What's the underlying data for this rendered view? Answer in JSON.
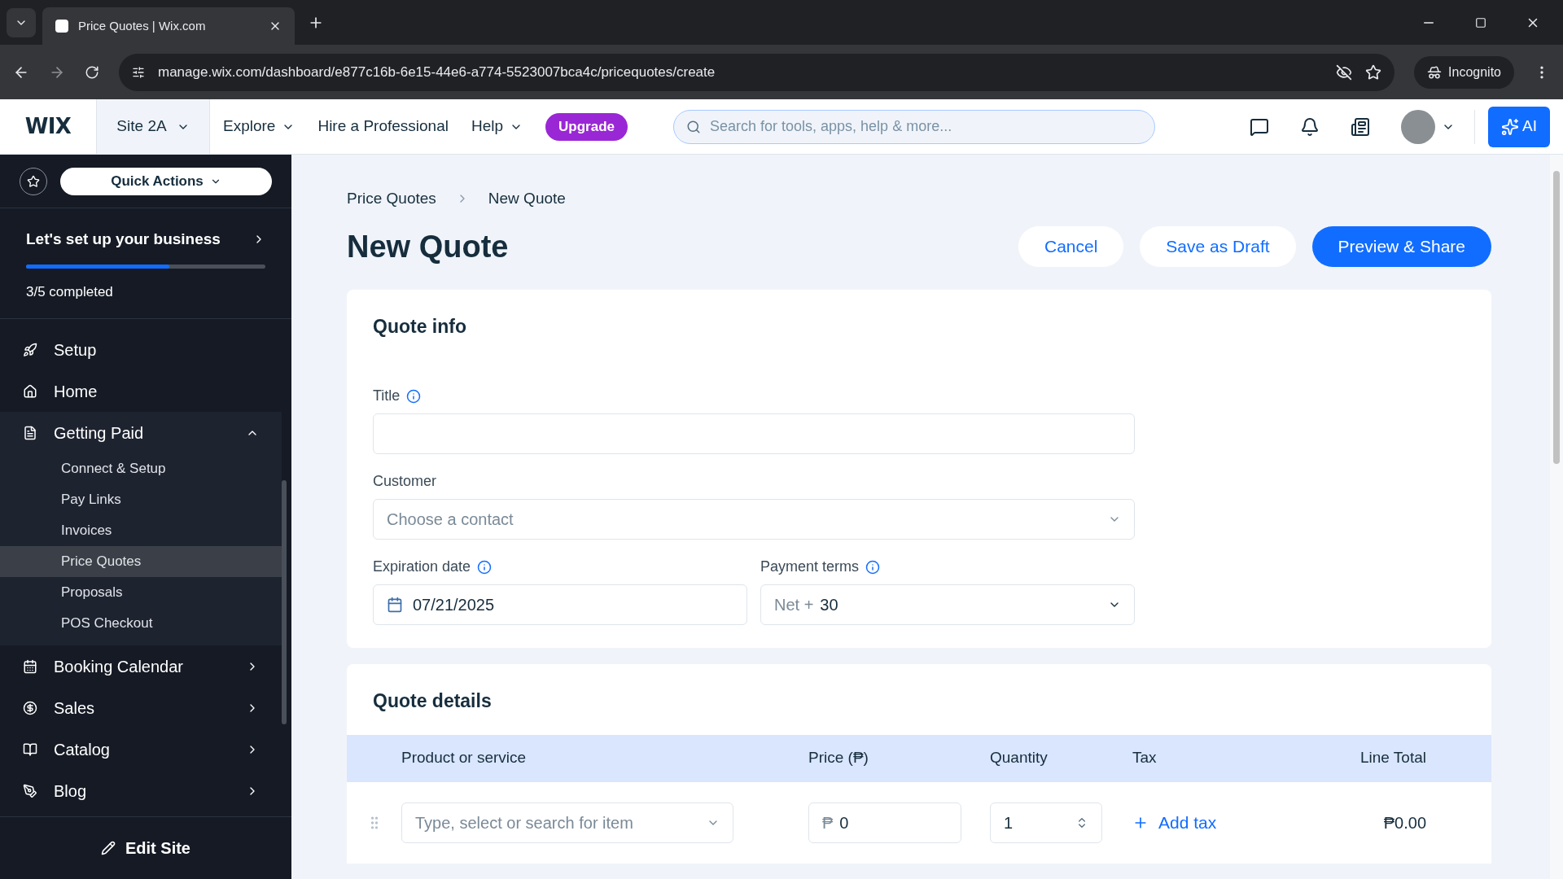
{
  "browser": {
    "tab_title": "Price Quotes | Wix.com",
    "url": "manage.wix.com/dashboard/e877c16b-6e15-44e6-a774-5523007bca4c/pricequotes/create",
    "profile": "Incognito"
  },
  "topbar": {
    "logo": "WIX",
    "site": "Site 2A",
    "nav": [
      {
        "label": "Explore",
        "dropdown": true
      },
      {
        "label": "Hire a Professional",
        "dropdown": false
      },
      {
        "label": "Help",
        "dropdown": true
      }
    ],
    "upgrade": "Upgrade",
    "search": {
      "placeholder": "Search for tools, apps, help & more..."
    },
    "ai": "AI"
  },
  "sidebar": {
    "quick_actions": "Quick Actions",
    "setup": {
      "title": "Let's set up your business",
      "level": 0.6,
      "progress": "3/5 completed"
    },
    "items": [
      {
        "label": "Setup",
        "expanded": false,
        "has_arrow": false
      },
      {
        "label": "Home",
        "expanded": false,
        "has_arrow": false
      },
      {
        "label": "Getting Paid",
        "expanded": true,
        "has_arrow": true,
        "children": [
          {
            "label": "Connect & Setup",
            "selected": false
          },
          {
            "label": "Pay Links",
            "selected": false
          },
          {
            "label": "Invoices",
            "selected": false
          },
          {
            "label": "Price Quotes",
            "selected": true
          },
          {
            "label": "Proposals",
            "selected": false
          },
          {
            "label": "POS Checkout",
            "selected": false
          }
        ]
      },
      {
        "label": "Booking Calendar",
        "expanded": false,
        "has_arrow": true
      },
      {
        "label": "Sales",
        "expanded": false,
        "has_arrow": true
      },
      {
        "label": "Catalog",
        "expanded": false,
        "has_arrow": true
      },
      {
        "label": "Blog",
        "expanded": false,
        "has_arrow": true
      }
    ],
    "edit_site": "Edit Site"
  },
  "breadcrumbs": [
    "Price Quotes",
    "New Quote"
  ],
  "page_title": "New Quote",
  "actions": [
    {
      "label": "Cancel",
      "kind": "secondary"
    },
    {
      "label": "Save as Draft",
      "kind": "secondary"
    },
    {
      "label": "Preview & Share",
      "kind": "primary"
    }
  ],
  "quote_info": {
    "heading": "Quote info",
    "title_label": "Title",
    "customer_label": "Customer",
    "customer_placeholder": "Choose a contact",
    "expiration_label": "Expiration date",
    "expiration_value": "07/21/2025",
    "terms_label": "Payment terms",
    "terms_prefix": "Net +",
    "terms_value": "30"
  },
  "quote_details": {
    "heading": "Quote details",
    "columns": [
      "Product or service",
      "Price (₱)",
      "Quantity",
      "Tax",
      "Line Total"
    ],
    "rows": [
      {
        "item_placeholder": "Type, select or search for item",
        "price_prefix": "₱",
        "price": "0",
        "quantity": "1",
        "add_tax": "Add tax",
        "line_total": "₱0.00"
      }
    ]
  }
}
